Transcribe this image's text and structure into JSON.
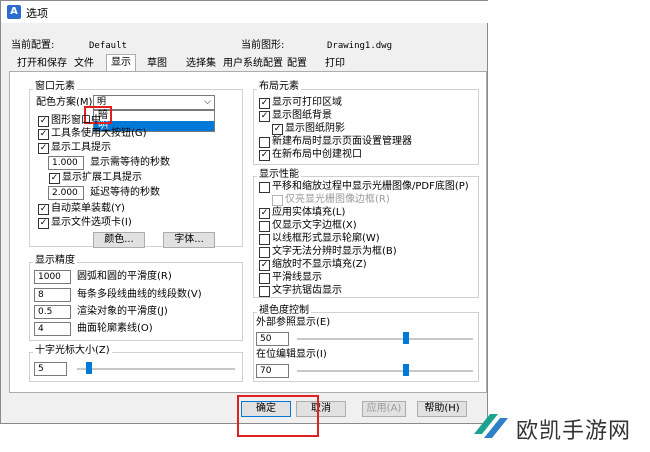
{
  "window": {
    "title": "选项"
  },
  "header": {
    "current_profile_label": "当前配置:",
    "current_profile_value": "Default",
    "current_drawing_label": "当前图形:",
    "current_drawing_value": "Drawing1.dwg"
  },
  "tabs": [
    "打开和保存",
    "文件",
    "显示",
    "草图",
    "选择集",
    "用户系统配置",
    "配置",
    "打印"
  ],
  "active_tab": "显示",
  "window_elements": {
    "title": "窗口元素",
    "color_scheme_label": "配色方案(M)",
    "color_scheme_value": "明",
    "color_scheme_options": [
      "暗",
      "明"
    ],
    "checkboxes": [
      {
        "label": "图形窗口中",
        "checked": true
      },
      {
        "label": "工具条使用大按钮(G)",
        "checked": true
      },
      {
        "label": "显示工具提示",
        "checked": true
      },
      {
        "label": "显示扩展工具提示",
        "checked": true
      },
      {
        "label": "自动菜单装载(Y)",
        "checked": true
      },
      {
        "label": "显示文件选项卡(I)",
        "checked": true
      }
    ],
    "tooltip_delay_value": "1.000",
    "tooltip_delay_label": "显示需等待的秒数",
    "ext_delay_value": "2.000",
    "ext_delay_label": "延迟等待的秒数",
    "colors_button": "颜色...",
    "fonts_button": "字体..."
  },
  "display_precision": {
    "title": "显示精度",
    "rows": [
      {
        "value": "1000",
        "label": "圆弧和圆的平滑度(R)"
      },
      {
        "value": "8",
        "label": "每条多段线曲线的线段数(V)"
      },
      {
        "value": "0.5",
        "label": "渲染对象的平滑度(J)"
      },
      {
        "value": "4",
        "label": "曲面轮廓素线(O)"
      }
    ]
  },
  "crosshair": {
    "title": "十字光标大小(Z)",
    "value": "5",
    "level": 5
  },
  "layout_elements": {
    "title": "布局元素",
    "items": [
      {
        "label": "显示可打印区域",
        "checked": true
      },
      {
        "label": "显示图纸背景",
        "checked": true
      },
      {
        "label": "显示图纸阴影",
        "checked": true
      },
      {
        "label": "新建布局时显示页面设置管理器",
        "checked": false
      },
      {
        "label": "在新布局中创建视口",
        "checked": true
      }
    ]
  },
  "display_performance": {
    "title": "显示性能",
    "items": [
      {
        "label": "平移和缩放过程中显示光栅图像/PDF底图(P)",
        "checked": false,
        "disabled": false
      },
      {
        "label": "仅亮显光栅图像边框(R)",
        "checked": false,
        "disabled": true
      },
      {
        "label": "应用实体填充(L)",
        "checked": true,
        "disabled": false
      },
      {
        "label": "仅显示文字边框(X)",
        "checked": false,
        "disabled": false
      },
      {
        "label": "以线框形式显示轮廓(W)",
        "checked": false,
        "disabled": false
      },
      {
        "label": "文字无法分辨时显示为框(B)",
        "checked": false,
        "disabled": false
      },
      {
        "label": "缩放时不显示填充(Z)",
        "checked": true,
        "disabled": false
      },
      {
        "label": "平滑线显示",
        "checked": false,
        "disabled": false
      },
      {
        "label": "文字抗锯齿显示",
        "checked": false,
        "disabled": false
      }
    ]
  },
  "fade_control": {
    "title": "褪色度控制",
    "xref_label": "外部参照显示(E)",
    "xref_value": "50",
    "inplace_label": "在位编辑显示(I)",
    "inplace_value": "70"
  },
  "buttons": {
    "ok": "确定",
    "cancel": "取消",
    "apply": "应用(A)",
    "help": "帮助(H)"
  },
  "watermark": {
    "text": "欧凯手游网"
  },
  "colors": {
    "accent": "#0078d7",
    "highlight_box": "#e02020",
    "logo": "#17a398"
  }
}
